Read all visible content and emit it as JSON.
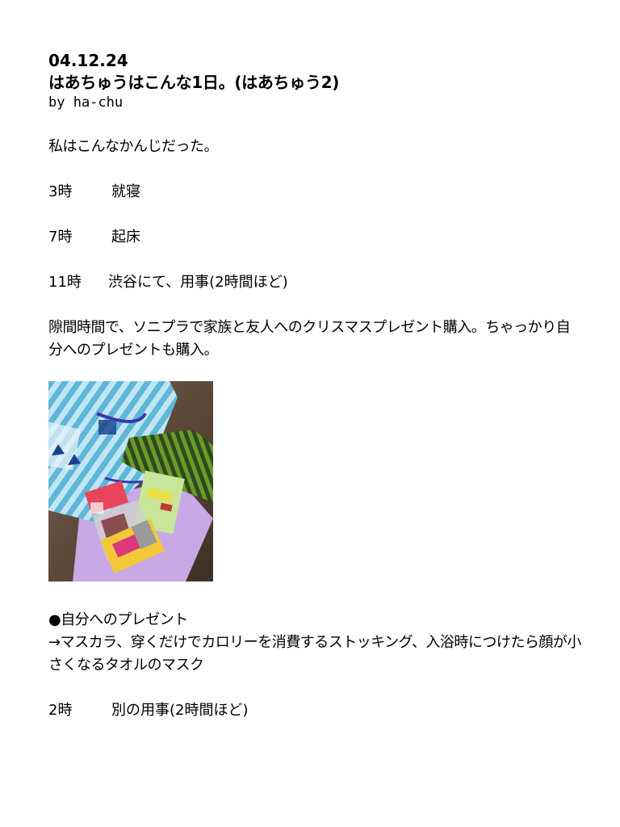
{
  "header": {
    "date": "04.12.24",
    "title": "はあちゅうはこんな1日。(はあちゅう2)",
    "byline": "by ha-chu"
  },
  "intro": "私はこんなかんじだった。",
  "schedule": [
    {
      "time": "3時",
      "text": "就寝"
    },
    {
      "time": "7時",
      "text": "起床"
    },
    {
      "time": "11時",
      "text": "渋谷にて、用事(2時間ほど)"
    }
  ],
  "shopping_paragraph": "隙間時間で、ソニプラで家族と友人へのクリスマスプレゼント購入。ちゃっかり自分へのプレゼントも購入。",
  "photo": {
    "icon": "shopping-bag-photo"
  },
  "gift": {
    "heading": "●自分へのプレゼント",
    "detail": "→マスカラ、穿くだけでカロリーを消費するストッキング、入浴時につけたら顔が小さくなるタオルのマスク"
  },
  "last_entry": {
    "time": "2時",
    "text": "別の用事(2時間ほど)"
  }
}
